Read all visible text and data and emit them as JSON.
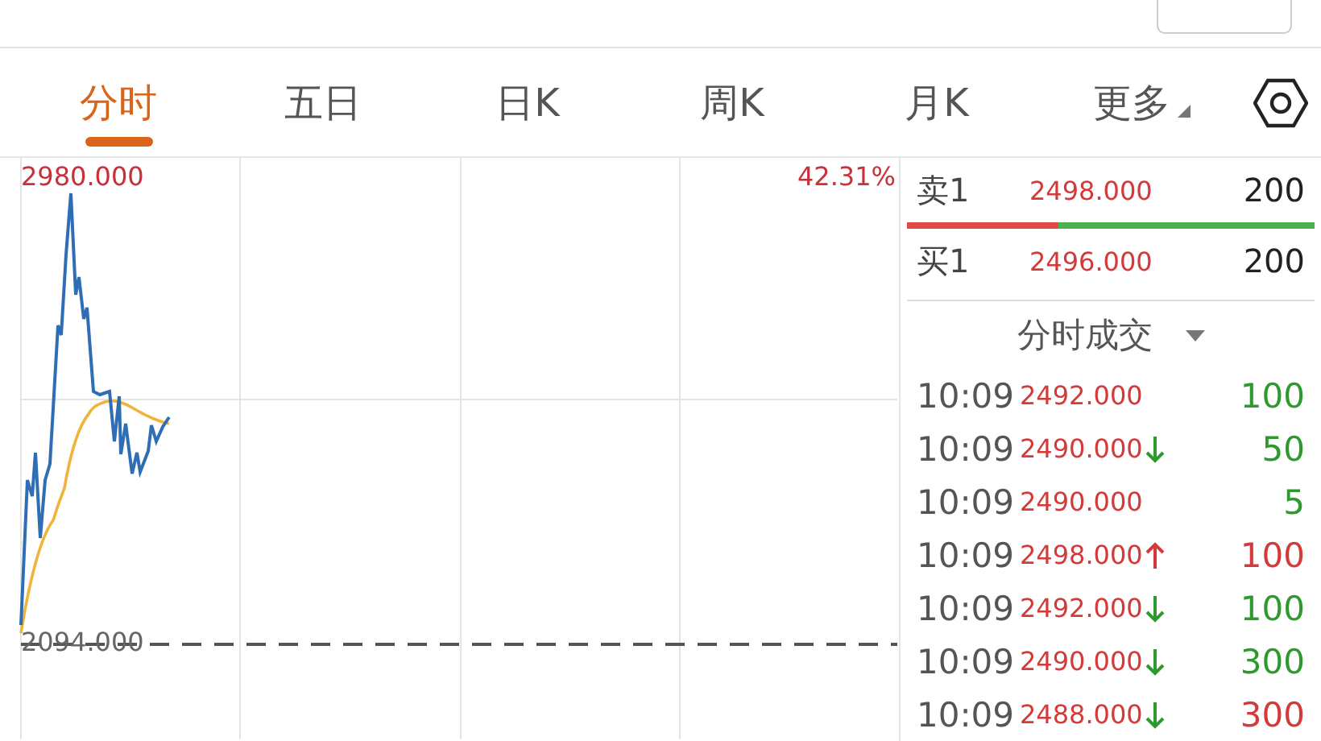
{
  "tabs": [
    {
      "label": "分时",
      "selected": true
    },
    {
      "label": "五日",
      "selected": false
    },
    {
      "label": "日K",
      "selected": false
    },
    {
      "label": "周K",
      "selected": false
    },
    {
      "label": "月K",
      "selected": false
    },
    {
      "label": "更多",
      "selected": false,
      "kind": "dropdown"
    }
  ],
  "chart": {
    "high_label": "2980.000",
    "change_label": "42.31%",
    "base_label": "2094.000"
  },
  "order_book": {
    "ask": {
      "label": "卖1",
      "price": "2498.000",
      "volume": "200"
    },
    "bid": {
      "label": "买1",
      "price": "2496.000",
      "volume": "200"
    },
    "ratio": {
      "level": 0.37
    }
  },
  "trades_header": "分时成交",
  "trades": [
    {
      "time": "10:09",
      "price": "2492.000",
      "rising": false,
      "falling": false,
      "volume": "100",
      "color": "#2e9a2e"
    },
    {
      "time": "10:09",
      "price": "2490.000",
      "rising": false,
      "falling": true,
      "volume": "50",
      "color": "#2e9a2e"
    },
    {
      "time": "10:09",
      "price": "2490.000",
      "rising": false,
      "falling": false,
      "volume": "5",
      "color": "#2e9a2e"
    },
    {
      "time": "10:09",
      "price": "2498.000",
      "rising": true,
      "falling": false,
      "volume": "100",
      "color": "#d33a3a"
    },
    {
      "time": "10:09",
      "price": "2492.000",
      "rising": false,
      "falling": true,
      "volume": "100",
      "color": "#2e9a2e"
    },
    {
      "time": "10:09",
      "price": "2490.000",
      "rising": false,
      "falling": true,
      "volume": "300",
      "color": "#2e9a2e"
    },
    {
      "time": "10:09",
      "price": "2488.000",
      "rising": false,
      "falling": true,
      "volume": "300",
      "color": "#d33a3a"
    }
  ]
}
